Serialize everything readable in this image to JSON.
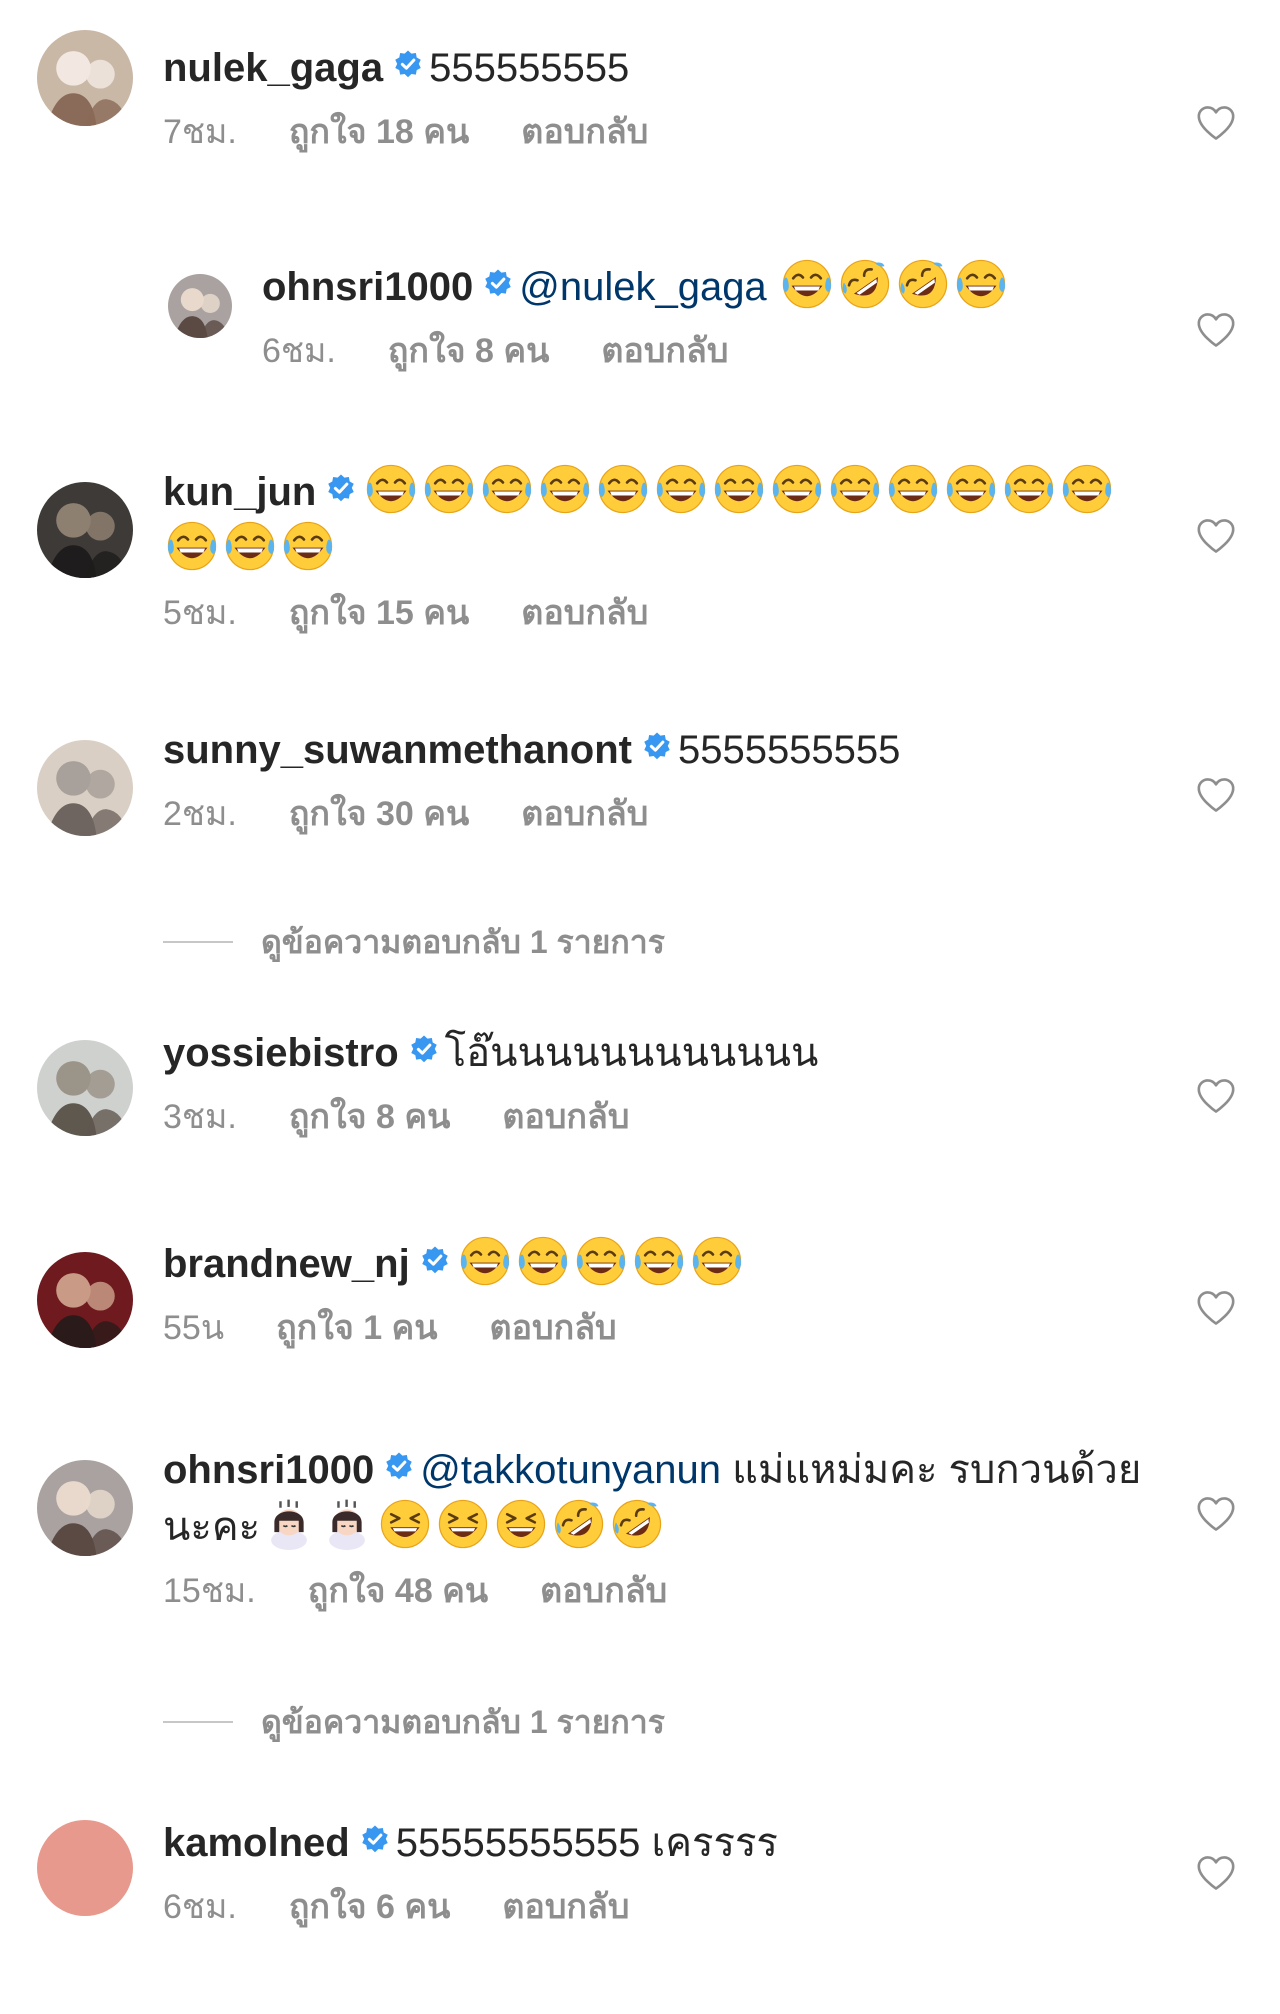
{
  "comments": [
    {
      "username": "nulek_gaga",
      "verified": true,
      "mention": "",
      "text": "555555555",
      "emojis": [],
      "time": "7ชม.",
      "likes": "ถูกใจ 18 คน",
      "reply_label": "ตอบกลับ",
      "avatar_icon": "avatar-photo",
      "is_reply": false
    },
    {
      "username": "ohnsri1000",
      "verified": true,
      "mention": "@nulek_gaga",
      "text": "",
      "emojis": [
        "joy",
        "rofl",
        "rofl",
        "joy"
      ],
      "time": "6ชม.",
      "likes": "ถูกใจ 8 คน",
      "reply_label": "ตอบกลับ",
      "avatar_icon": "avatar-photo",
      "is_reply": true
    },
    {
      "username": "kun_jun",
      "verified": true,
      "mention": "",
      "text": "",
      "emojis": [
        "joy",
        "joy",
        "joy",
        "joy",
        "joy",
        "joy",
        "joy",
        "joy",
        "joy",
        "joy",
        "joy",
        "joy",
        "joy",
        "joy",
        "joy",
        "joy"
      ],
      "time": "5ชม.",
      "likes": "ถูกใจ 15 คน",
      "reply_label": "ตอบกลับ",
      "avatar_icon": "avatar-photo",
      "is_reply": false
    },
    {
      "username": "sunny_suwanmethanont",
      "verified": true,
      "mention": "",
      "text": "5555555555",
      "emojis": [],
      "time": "2ชม.",
      "likes": "ถูกใจ 30 คน",
      "reply_label": "ตอบกลับ",
      "avatar_icon": "avatar-photo",
      "is_reply": false,
      "view_replies": "ดูข้อความตอบกลับ 1 รายการ"
    },
    {
      "username": "yossiebistro",
      "verified": true,
      "mention": "",
      "text": "โอ๊นนนนนนนนนนนน",
      "emojis": [],
      "time": "3ชม.",
      "likes": "ถูกใจ 8 คน",
      "reply_label": "ตอบกลับ",
      "avatar_icon": "avatar-photo",
      "is_reply": false
    },
    {
      "username": "brandnew_nj",
      "verified": true,
      "mention": "",
      "text": "",
      "emojis": [
        "joy",
        "joy",
        "joy",
        "joy",
        "joy"
      ],
      "time": "55น",
      "likes": "ถูกใจ 1 คน",
      "reply_label": "ตอบกลับ",
      "avatar_icon": "avatar-photo",
      "is_reply": false
    },
    {
      "username": "ohnsri1000",
      "verified": true,
      "mention": "@takkotunyanun",
      "text": "แม่แหม่มคะ รบกวนด้วยนะคะ",
      "emojis": [
        "woman-bowing",
        "woman-bowing",
        "laughing",
        "laughing",
        "laughing",
        "rofl",
        "rofl"
      ],
      "time": "15ชม.",
      "likes": "ถูกใจ 48 คน",
      "reply_label": "ตอบกลับ",
      "avatar_icon": "avatar-photo",
      "is_reply": false,
      "view_replies": "ดูข้อความตอบกลับ 1 รายการ"
    },
    {
      "username": "kamolned",
      "verified": true,
      "mention": "",
      "text": "55555555555 เครรรร",
      "emojis": [],
      "time": "6ชม.",
      "likes": "ถูกใจ 6 คน",
      "reply_label": "ตอบกลับ",
      "avatar_icon": "avatar-blank",
      "is_reply": false
    }
  ],
  "colors": {
    "username": "#262626",
    "mention": "#00376b",
    "meta": "#8e8e8e",
    "verified_badge": "#3897f0",
    "blank_avatar": "#e8998d"
  }
}
